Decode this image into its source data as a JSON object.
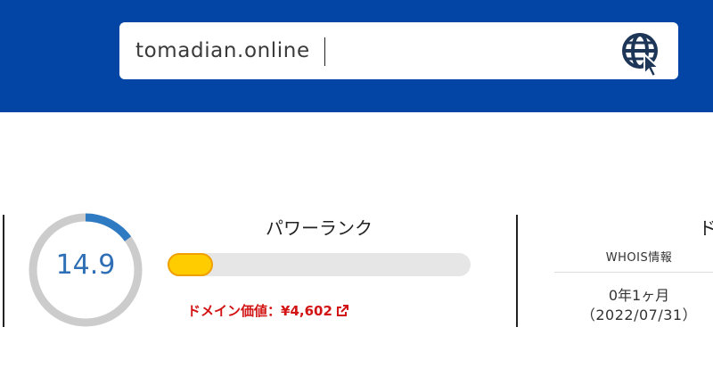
{
  "search": {
    "value": "tomadian.online"
  },
  "power_rank": {
    "title": "パワーランク",
    "score": "14.9",
    "score_fraction": 0.149,
    "bar_fraction": 0.149,
    "colors": {
      "gauge_track": "#cccccc",
      "gauge_fill": "#2e7bc4",
      "bar_fill": "#ffcc00",
      "bar_track": "#e6e6e6"
    }
  },
  "domain_value": {
    "label": "ドメイン価値：",
    "amount": "¥4,602",
    "icon": "external-link-icon"
  },
  "whois": {
    "heading_partial": "ド",
    "label": "WHOIS情報",
    "age": "0年1ヶ月",
    "registered": "（2022/07/31）"
  },
  "theme": {
    "header_bg": "#0245a4",
    "value_color": "#d21414",
    "icon": "globe-cursor-icon"
  }
}
